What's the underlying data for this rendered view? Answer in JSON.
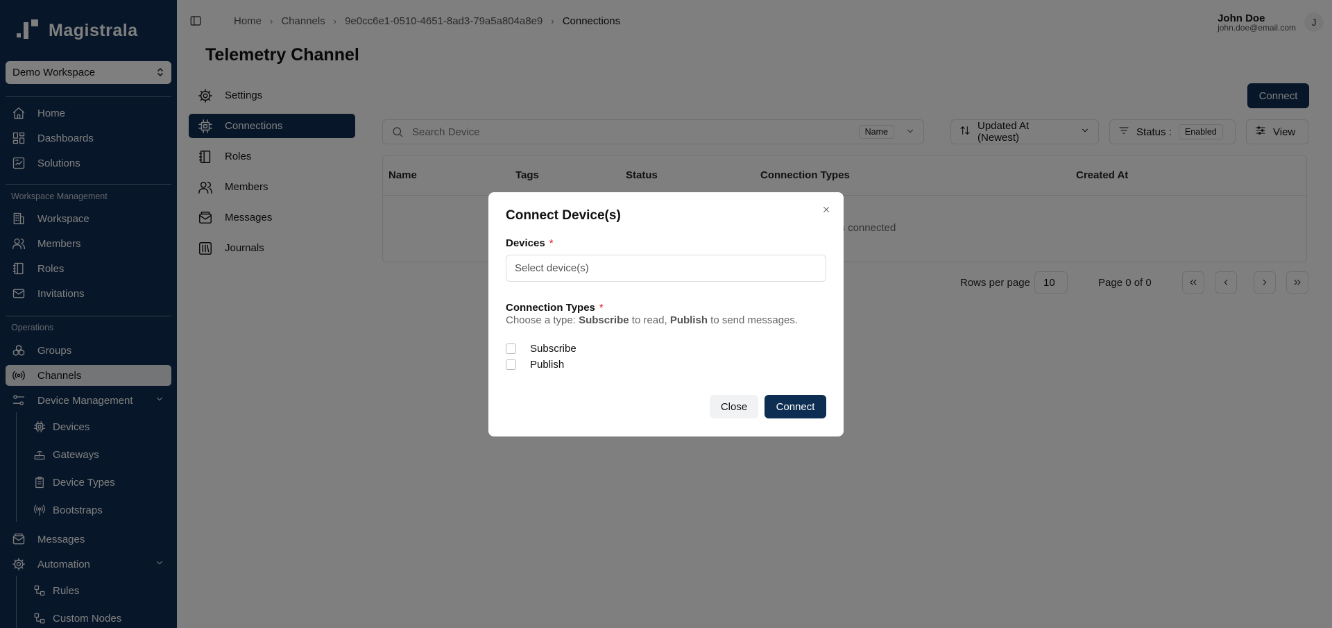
{
  "app": {
    "name": "Magistrala"
  },
  "workspace_select": {
    "value": "Demo Workspace"
  },
  "sidebar": {
    "primary": [
      {
        "label": "Home",
        "icon": "home-icon"
      },
      {
        "label": "Dashboards",
        "icon": "dashboard-icon"
      },
      {
        "label": "Solutions",
        "icon": "solutions-icon"
      }
    ],
    "workspace_management_label": "Workspace Management",
    "workspace_management": [
      {
        "label": "Workspace",
        "icon": "building-icon"
      },
      {
        "label": "Members",
        "icon": "users-icon"
      },
      {
        "label": "Roles",
        "icon": "notebook-icon"
      },
      {
        "label": "Invitations",
        "icon": "mail-icon"
      }
    ],
    "operations_label": "Operations",
    "operations": [
      {
        "label": "Groups",
        "icon": "groups-icon"
      },
      {
        "label": "Channels",
        "icon": "radio-icon",
        "active": true
      },
      {
        "label": "Device Management",
        "icon": "sliders-icon",
        "expanded": true
      }
    ],
    "device_management_items": [
      {
        "label": "Devices",
        "icon": "chip-icon"
      },
      {
        "label": "Gateways",
        "icon": "router-icon"
      },
      {
        "label": "Device Types",
        "icon": "clipboard-icon"
      },
      {
        "label": "Bootstraps",
        "icon": "broadcast-icon"
      }
    ],
    "after_device": [
      {
        "label": "Messages",
        "icon": "mail-open-icon"
      },
      {
        "label": "Automation",
        "icon": "gear-icon",
        "expanded": true
      }
    ],
    "automation_items": [
      {
        "label": "Rules",
        "icon": "workflow-icon"
      },
      {
        "label": "Custom Nodes",
        "icon": "workflow-icon"
      }
    ]
  },
  "breadcrumb": [
    "Home",
    "Channels",
    "9e0cc6e1-0510-4651-8ad3-79a5a804a8e9",
    "Connections"
  ],
  "user": {
    "name": "John Doe",
    "email": "john.doe@email.com",
    "initial": "J"
  },
  "page": {
    "title": "Telemetry Channel"
  },
  "tabs": [
    {
      "label": "Settings",
      "icon": "gear-icon"
    },
    {
      "label": "Connections",
      "icon": "chip-icon",
      "active": true
    },
    {
      "label": "Roles",
      "icon": "notebook-icon"
    },
    {
      "label": "Members",
      "icon": "users-icon"
    },
    {
      "label": "Messages",
      "icon": "mail-open-icon"
    },
    {
      "label": "Journals",
      "icon": "library-icon"
    }
  ],
  "toolbar": {
    "connect_label": "Connect",
    "search_placeholder": "Search Device",
    "search_field": "Name",
    "sort_label": "Updated At (Newest)",
    "status_label": "Status :",
    "status_value": "Enabled",
    "view_label": "View"
  },
  "table": {
    "columns": [
      "Name",
      "Tags",
      "Status",
      "Connection Types",
      "Created At"
    ],
    "empty_message": "No devices connected"
  },
  "pagination": {
    "rows_per_page_label": "Rows per page",
    "rows_per_page": "10",
    "page_info": "Page 0 of 0"
  },
  "dialog": {
    "title": "Connect Device(s)",
    "devices_label": "Devices",
    "devices_placeholder": "Select device(s)",
    "required_mark": "*",
    "connection_types_label": "Connection Types",
    "hint_prefix": "Choose a type: ",
    "hint_subscribe": "Subscribe",
    "hint_middle": " to read, ",
    "hint_publish": "Publish",
    "hint_suffix": " to send messages.",
    "options": [
      "Subscribe",
      "Publish"
    ],
    "close_label": "Close",
    "connect_label": "Connect"
  }
}
